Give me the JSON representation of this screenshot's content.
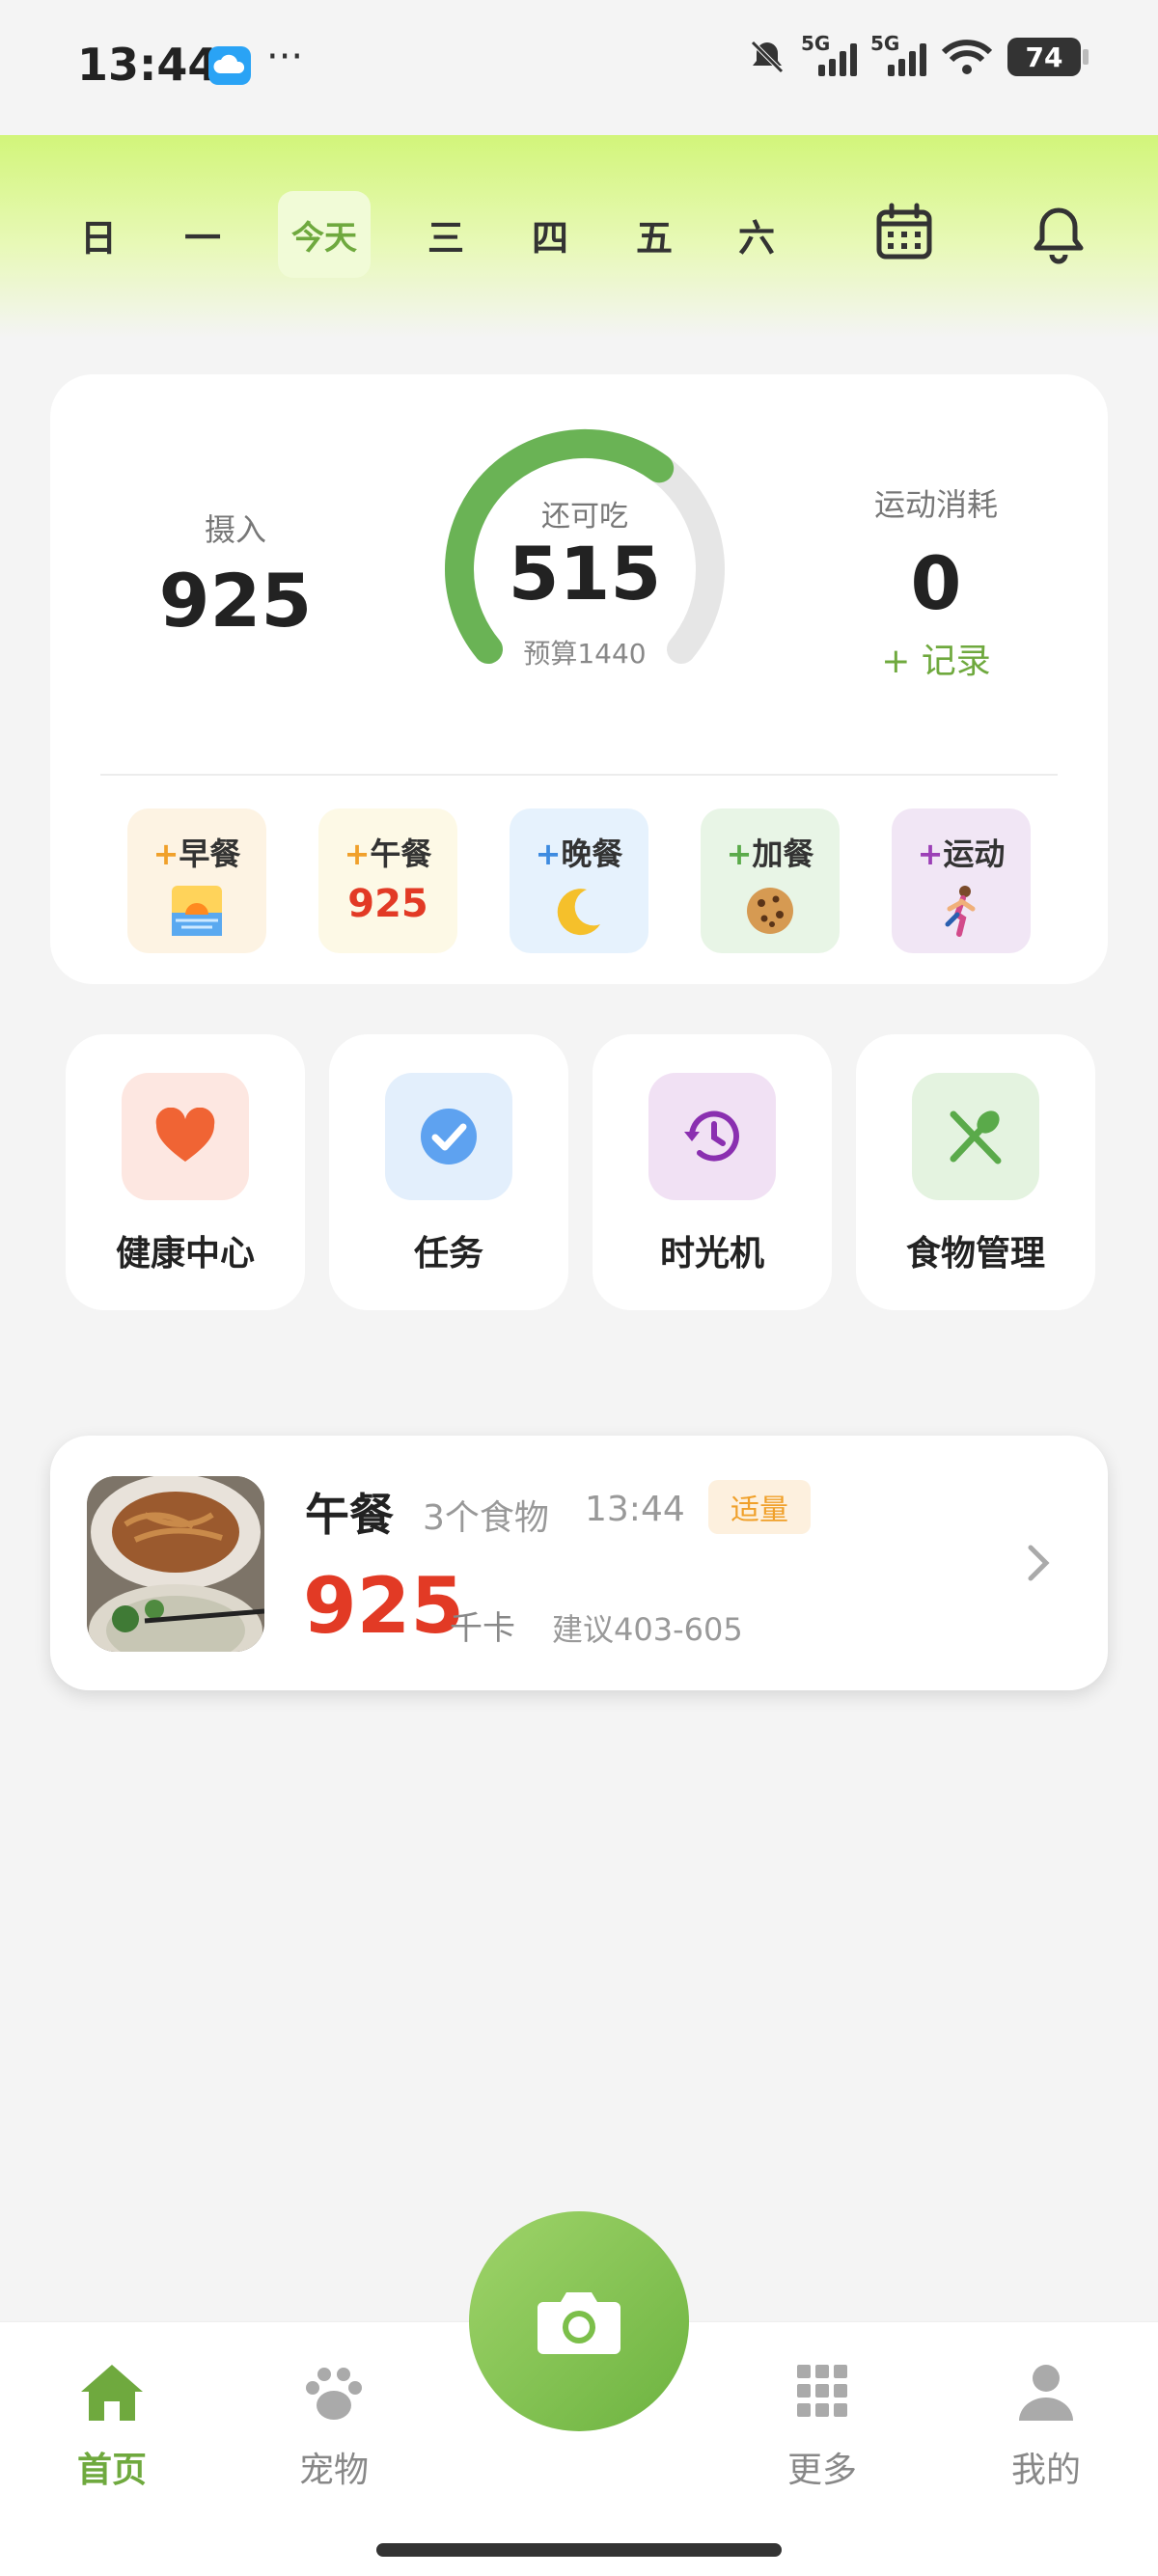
{
  "status_bar": {
    "time": "13:44",
    "dots": "···",
    "network1": "5G",
    "network2": "5G",
    "battery": "74"
  },
  "week": {
    "days": [
      "日",
      "一",
      "今天",
      "三",
      "四",
      "五",
      "六"
    ],
    "selected": "今天"
  },
  "summary": {
    "intake_label": "摄入",
    "intake_value": "925",
    "remaining_label": "还可吃",
    "remaining_value": "515",
    "budget_text": "预算1440",
    "budget_progress": 0.64,
    "exercise_label": "运动消耗",
    "exercise_value": "0",
    "record_link": "+ 记录"
  },
  "meals": [
    {
      "plus": "+",
      "label": "早餐",
      "icon": "sunrise-icon",
      "value": ""
    },
    {
      "plus": "+",
      "label": "午餐",
      "icon": "",
      "value": "925"
    },
    {
      "plus": "+",
      "label": "晚餐",
      "icon": "crescent-moon-icon",
      "value": ""
    },
    {
      "plus": "+",
      "label": "加餐",
      "icon": "cookie-icon",
      "value": ""
    },
    {
      "plus": "+",
      "label": "运动",
      "icon": "runner-icon",
      "value": ""
    }
  ],
  "tiles": [
    {
      "label": "健康中心",
      "icon": "heart-icon"
    },
    {
      "label": "任务",
      "icon": "check-circle-icon"
    },
    {
      "label": "时光机",
      "icon": "history-icon"
    },
    {
      "label": "食物管理",
      "icon": "fork-spoon-icon"
    }
  ],
  "meal_card": {
    "title": "午餐",
    "count": "3个食物",
    "time": "13:44",
    "badge": "适量",
    "kcal": "925",
    "unit": "千卡",
    "suggestion": "建议403-605"
  },
  "nav": {
    "items": [
      {
        "label": "首页",
        "icon": "home-icon",
        "active": true
      },
      {
        "label": "宠物",
        "icon": "paw-icon",
        "active": false
      },
      {
        "label": "更多",
        "icon": "grid-icon",
        "active": false
      },
      {
        "label": "我的",
        "icon": "person-icon",
        "active": false
      }
    ],
    "center": "camera-icon"
  },
  "colors": {
    "accent_green": "#6fa93e",
    "calorie_red": "#e23a25",
    "badge_orange": "#f0a02a",
    "header_lime": "#d2f57a"
  }
}
